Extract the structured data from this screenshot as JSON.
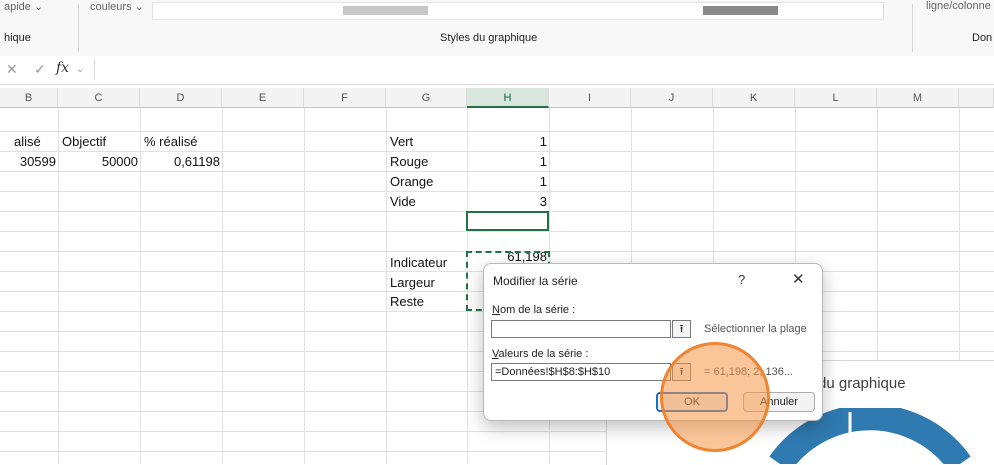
{
  "ribbon": {
    "top_items": [
      "apide ⌄",
      "couleurs ⌄",
      "ligne/colonne"
    ],
    "groups": [
      "hique",
      "Styles du graphique",
      "Don"
    ]
  },
  "formula_bar": {
    "fx": "fx",
    "value": ""
  },
  "columns": [
    "B",
    "C",
    "D",
    "E",
    "F",
    "G",
    "H",
    "I",
    "J",
    "K",
    "L",
    "M"
  ],
  "cells": {
    "b1": "alisé",
    "c1": "Objectif",
    "d1": "% réalisé",
    "b2": "30599",
    "c2": "50000",
    "d2": "0,61198",
    "g1": "Vert",
    "h1": "1",
    "g2": "Rouge",
    "h2": "1",
    "g3": "Orange",
    "h3": "1",
    "g4": "Vide",
    "h4": "3",
    "g7": "Indicateur",
    "h7": "61,198",
    "g8": "Largeur",
    "g9": "Reste"
  },
  "chart": {
    "title": "du graphique",
    "ring_color": "#2f7ab0"
  },
  "dialog": {
    "title": "Modifier la série",
    "help": "?",
    "close": "✕",
    "name_label_u": "N",
    "name_label_rest": "om de la série :",
    "name_value": "",
    "name_hint": "Sélectionner la plage",
    "values_label_u": "V",
    "values_label_rest": "aleurs de la série :",
    "values_value": "=Données!$H$8:$H$10",
    "values_preview": "= 61,198; 2, 136...",
    "collapse_icon": "⭱",
    "ok": "OK",
    "cancel": "Annuler"
  }
}
